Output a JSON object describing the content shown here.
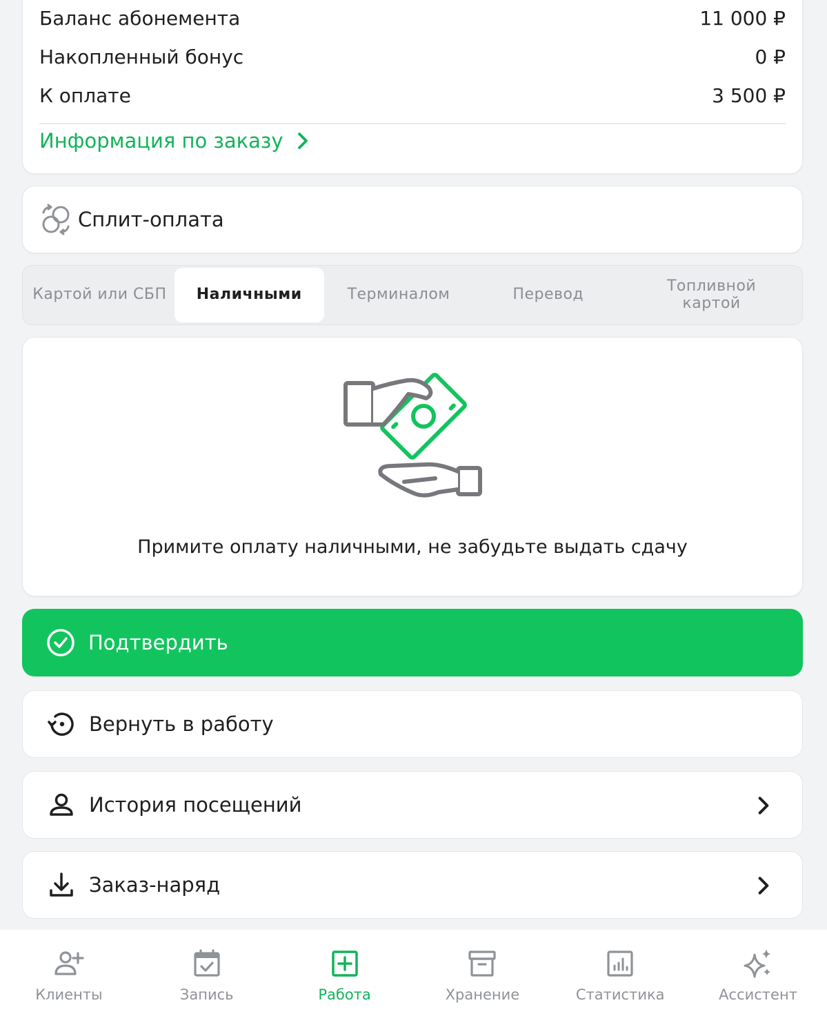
{
  "summary": {
    "rows": [
      {
        "label": "Баланс абонемента",
        "value": "11 000 ₽"
      },
      {
        "label": "Накопленный бонус",
        "value": "0 ₽"
      },
      {
        "label": "К оплате",
        "value": "3 500 ₽"
      }
    ],
    "info_link": "Информация по заказу"
  },
  "split": {
    "label": "Сплит-оплата",
    "icon": "split-payment-icon"
  },
  "tabs": [
    {
      "label": "Картой или СБП",
      "active": false
    },
    {
      "label": "Наличными",
      "active": true
    },
    {
      "label": "Терминалом",
      "active": false
    },
    {
      "label": "Перевод",
      "active": false
    },
    {
      "label": "Топливной картой",
      "active": false
    }
  ],
  "cash": {
    "message": "Примите оплату наличными, не забудьте выдать сдачу",
    "icon": "cash-handover-icon"
  },
  "actions": {
    "confirm_label": "Подтвердить",
    "return_label": "Вернуть в работу",
    "history_label": "История посещений",
    "order_label": "Заказ-наряд"
  },
  "nav": [
    {
      "label": "Клиенты",
      "icon": "add-user-icon",
      "active": false
    },
    {
      "label": "Запись",
      "icon": "calendar-check-icon",
      "active": false
    },
    {
      "label": "Работа",
      "icon": "plus-square-icon",
      "active": true
    },
    {
      "label": "Хранение",
      "icon": "archive-box-icon",
      "active": false
    },
    {
      "label": "Статистика",
      "icon": "chart-icon",
      "active": false
    },
    {
      "label": "Ассистент",
      "icon": "sparkles-icon",
      "active": false
    }
  ],
  "colors": {
    "accent": "#12c45e",
    "text": "#1f1f1f",
    "muted": "#8f9297",
    "background": "#f2f3f5"
  }
}
